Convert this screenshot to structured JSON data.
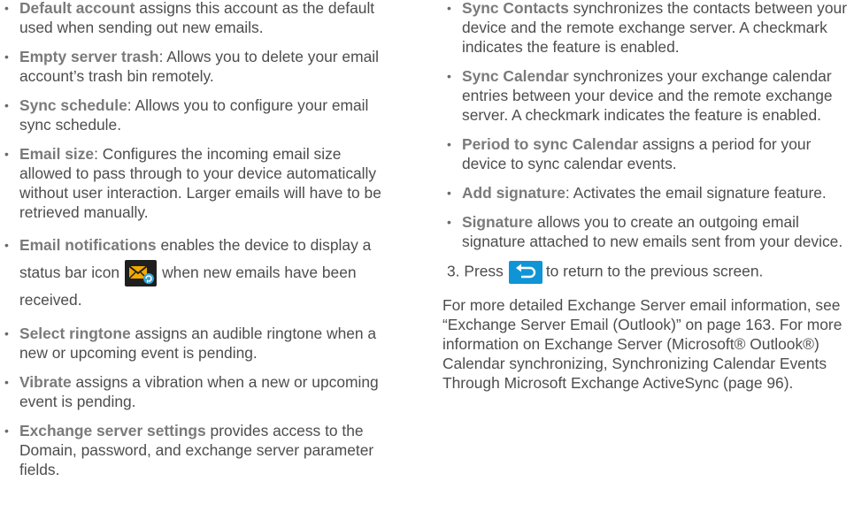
{
  "left_items": [
    {
      "term": "Default account",
      "text": " assigns this account as the default used when sending out new emails."
    },
    {
      "term": "Empty server trash",
      "text": ": Allows you to delete your email account’s trash bin remotely."
    },
    {
      "term": "Sync schedule",
      "text": ": Allows you to configure your email sync schedule."
    },
    {
      "term": "Email size",
      "text": ": Configures the incoming email size allowed to pass through to your device automatically without user interaction. Larger emails will have to be retrieved manually."
    },
    {
      "term": "Select ringtone",
      "text": " assigns an audible ringtone when a new or upcoming event is pending."
    },
    {
      "term": "Vibrate",
      "text": " assigns a vibration when a new or upcoming event is pending."
    },
    {
      "term": "Exchange server settings",
      "text": " provides access to the Domain, password, and exchange server parameter fields."
    }
  ],
  "notification_item": {
    "term": "Email notifications",
    "text_before": " enables the device to display a status bar icon",
    "text_after": "when new emails have been received.",
    "icon": "email-notification-icon"
  },
  "right_items": [
    {
      "term": "Sync Contacts",
      "text": " synchronizes the contacts between your device and the remote exchange server. A checkmark indicates the feature is enabled."
    },
    {
      "term": "Sync Calendar",
      "text": " synchronizes your exchange calendar entries between your device and the remote exchange server. A checkmark indicates the feature is enabled."
    },
    {
      "term": "Period to sync Calendar",
      "text": " assigns a period for your device to sync calendar events."
    },
    {
      "term": "Add signature",
      "text": ": Activates the email signature feature."
    },
    {
      "term": "Signature",
      "text": " allows you to create an outgoing email signature attached to new emails sent from your device."
    }
  ],
  "step": {
    "number": "3.",
    "before": "Press",
    "after": "to return to the previous screen.",
    "icon": "back-key-icon"
  },
  "paragraph": "For more detailed Exchange Server email information, see “Exchange Server Email (Outlook)” on page 163. For more information on Exchange Server (Microsoft® Outlook®) Calendar synchronizing, Synchronizing Calendar Events Through Microsoft Exchange ActiveSync (page 96).",
  "colors": {
    "text": "#4d4d4d",
    "term": "#7a7a7a",
    "icon_bg": "#1f1f1f",
    "icon_accent": "#f2a900",
    "back_icon_bg": "#0f95d6"
  }
}
